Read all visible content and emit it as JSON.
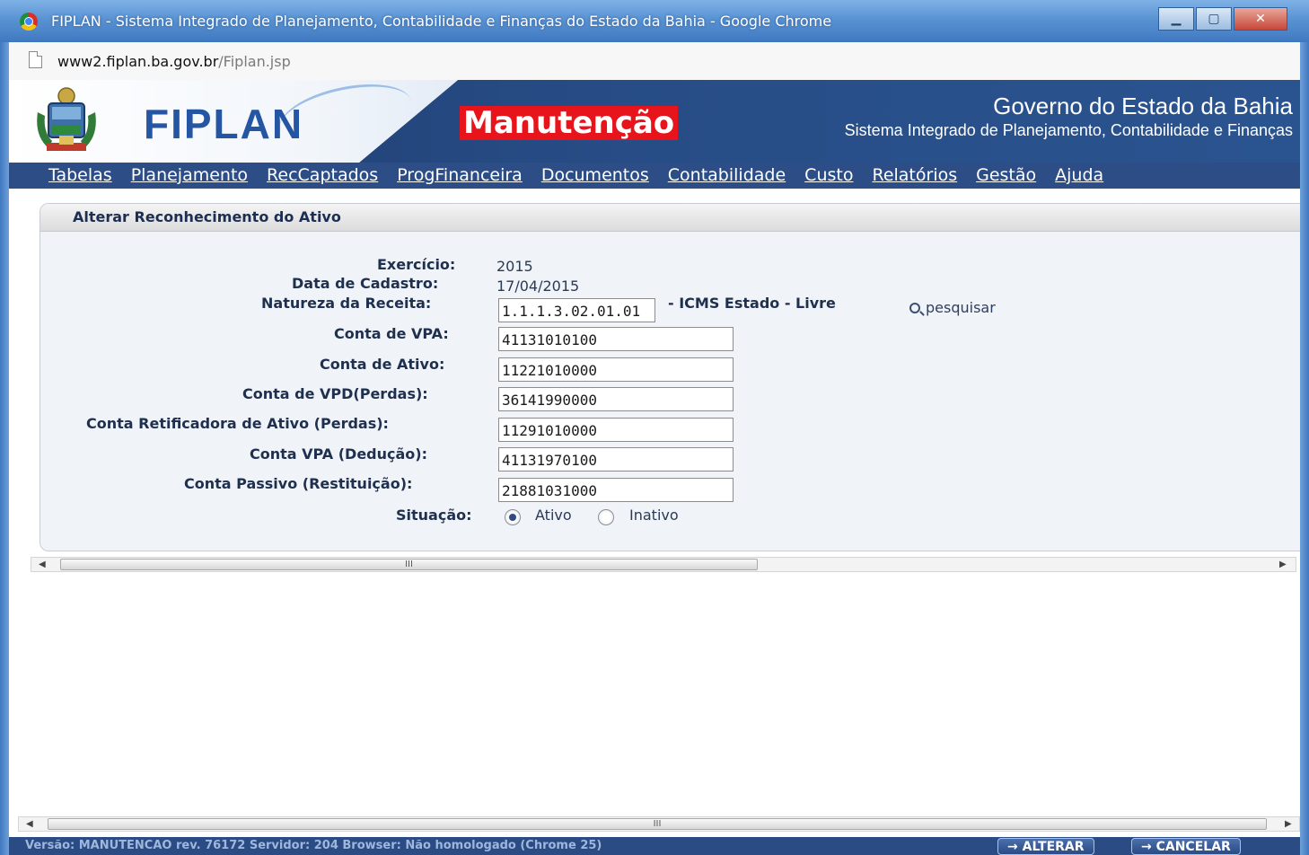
{
  "window": {
    "title": "FIPLAN - Sistema Integrado de Planejamento, Contabilidade e Finanças do Estado da Bahia - Google Chrome",
    "min_icon": "minimize-icon",
    "max_icon": "maximize-icon",
    "close_icon": "close-icon"
  },
  "address": {
    "domain": "www2.fiplan.ba.gov.br",
    "path": "/Fiplan.jsp"
  },
  "header": {
    "logo_text": "FIPLAN",
    "env_badge": "Manutenção",
    "gov_title": "Governo do Estado da Bahia",
    "system_name": "Sistema Integrado de Planejamento, Contabilidade e Finanças"
  },
  "menu": [
    "Tabelas",
    "Planejamento",
    "RecCaptados",
    "ProgFinanceira",
    "Documentos",
    "Contabilidade",
    "Custo",
    "Relatórios",
    "Gestão",
    "Ajuda"
  ],
  "form": {
    "title": "Alterar Reconhecimento do Ativo",
    "exercicio_label": "Exercício:",
    "exercicio_value": "2015",
    "data_label": "Data de Cadastro:",
    "data_value": "17/04/2015",
    "natureza_label": "Natureza da Receita:",
    "natureza_value": "1.1.1.3.02.01.01",
    "natureza_desc": "- ICMS Estado - Livre",
    "search_label": "pesquisar",
    "vpa_label": "Conta de VPA:",
    "vpa_value": "41131010100",
    "ativo_label": "Conta de Ativo:",
    "ativo_value": "11221010000",
    "vpd_label": "Conta de VPD(Perdas):",
    "vpd_value": "36141990000",
    "retif_label": "Conta Retificadora de Ativo (Perdas):",
    "retif_value": "11291010000",
    "deducao_label": "Conta VPA (Dedução):",
    "deducao_value": "41131970100",
    "passivo_label": "Conta Passivo (Restituição):",
    "passivo_value": "21881031000",
    "situacao_label": "Situação:",
    "situacao_options": [
      "Ativo",
      "Inativo"
    ],
    "situacao_selected": "Ativo"
  },
  "scrollbar": {
    "thumb_grip": "III",
    "left_arrow": "◀",
    "right_arrow": "▶"
  },
  "footer": {
    "status": "Versão: MANUTENCAO  rev. 76172   Servidor: 204  Browser: Não homologado (Chrome 25)",
    "alterar_label": "→ ALTERAR",
    "cancelar_label": "→ CANCELAR"
  }
}
